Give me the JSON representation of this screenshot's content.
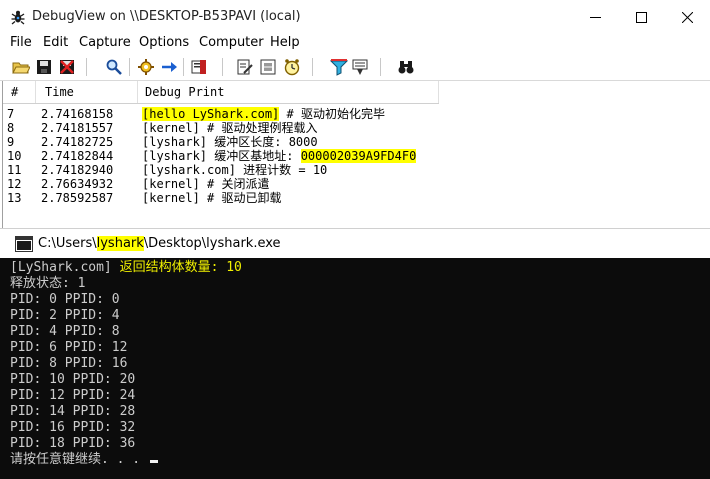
{
  "debugview": {
    "title": "DebugView on \\\\DESKTOP-B53PAVI (local)",
    "app_icon": "debugview-bug-icon",
    "window_controls": [
      "minimize-icon",
      "maximize-icon",
      "close-icon"
    ],
    "menu": [
      "File",
      "Edit",
      "Capture",
      "Options",
      "Computer",
      "Help"
    ],
    "toolbar": [
      "open-folder-icon",
      "save-icon",
      "clear-icon",
      "find-icon",
      "capture-gear-icon",
      "autoscroll-arrow-icon",
      "clear-display-icon",
      "edit-filter-icon",
      "history-icon",
      "clock-icon",
      "filter-funnel-icon",
      "highlight-icon",
      "binoculars-icon"
    ],
    "columns": [
      "#",
      "Time",
      "Debug Print"
    ],
    "rows": [
      {
        "num": "7",
        "time": "2.74168158",
        "msg_hl": "[hello LyShark.com]",
        "msg": " # 驱动初始化完毕"
      },
      {
        "num": "8",
        "time": "2.74181557",
        "msg": "[kernel] # 驱动处理例程载入"
      },
      {
        "num": "9",
        "time": "2.74182725",
        "msg": "[lyshark] 缓冲区长度: 8000"
      },
      {
        "num": "10",
        "time": "2.74182844",
        "msg": "[lyshark] 缓冲区基地址: ",
        "msg_tail_hl": "000002039A9FD4F0"
      },
      {
        "num": "11",
        "time": "2.74182940",
        "msg": "[lyshark.com] 进程计数 = 10"
      },
      {
        "num": "12",
        "time": "2.76634932",
        "msg": "[kernel] # 关闭派遣"
      },
      {
        "num": "13",
        "time": "2.78592587",
        "msg": "[kernel] # 驱动已卸载"
      }
    ]
  },
  "console": {
    "title_prefix": "C:\\Users\\",
    "title_user": "lyshark",
    "title_suffix": "\\Desktop\\lyshark.exe",
    "icon": "console-window-icon",
    "line0_prefix": "[LyShark.com] ",
    "line0_yellow": "返回结构体数量: 10",
    "lines": [
      "释放状态: 1",
      "PID: 0 PPID: 0",
      "PID: 2 PPID: 4",
      "PID: 4 PPID: 8",
      "PID: 6 PPID: 12",
      "PID: 8 PPID: 16",
      "PID: 10 PPID: 20",
      "PID: 12 PPID: 24",
      "PID: 14 PPID: 28",
      "PID: 16 PPID: 32",
      "PID: 18 PPID: 36",
      "请按任意键继续. . . "
    ]
  },
  "colors": {
    "highlight": "#ffff00",
    "console_bg": "#0c0c0c",
    "console_text": "#cccccc",
    "console_yellow": "#f0f000"
  }
}
